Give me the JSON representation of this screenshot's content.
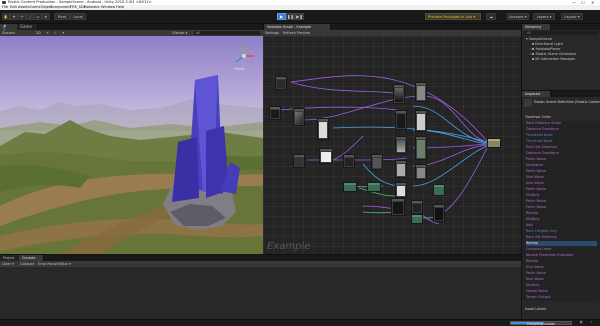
{
  "window": {
    "title": "Elastic Content Production - SampleScene - Android - Unity 2020.3.3f1 <DX11>",
    "controls": [
      "—",
      "☐",
      "✕"
    ]
  },
  "menu": [
    "File",
    "Edit",
    "Assets",
    "GameObject",
    "Component",
    "FRE_SDK",
    "Hololabs",
    "Window",
    "Help"
  ],
  "toolbar": {
    "tools": [
      "✋",
      "✥",
      "⟳",
      "⤢",
      "▭",
      "⊕"
    ],
    "pivot": "Pivot",
    "local": "Local",
    "package_badge": "Preview Packages in Use ▾",
    "account": "Account ▾",
    "layers": "Layers ▾",
    "layout": "Layout ▾",
    "play": "▶",
    "pause": "❚❚",
    "step": "▶❚"
  },
  "scene_panel": {
    "tabs": [
      "# Scene",
      "Game"
    ],
    "shading": "Shaded",
    "mode_2d": "2D",
    "gizmos": "Gizmos ▾",
    "search": "All",
    "persp_label": "<Persp"
  },
  "graph_panel": {
    "tab": "Hololabs Graph - Example",
    "settings": "Settings",
    "refresh": "Refresh Preview",
    "watermark": "Example"
  },
  "hierarchy": {
    "tab": "Hierarchy",
    "search": "All",
    "scene": "SampleScene",
    "items": [
      "Directional Light",
      "HololabsPlayer",
      "Elastic Scene Generator",
      "XR Interaction Manager"
    ]
  },
  "inspector": {
    "tab": "Inspector",
    "object_title": "Elastic Scene Definition (Elastic Content...",
    "section": "Traversal Order",
    "rows": [
      "Rock Distance Stripe",
      "Distance Transform",
      "Threshold Node",
      "Threshold Node",
      "Rock Set Distance",
      "Distance Transform",
      "Perlin Noise",
      "Normalize",
      "Perlin Noise",
      "Sine Wave",
      "Sine Wave",
      "Perlin Noise",
      "Multiply",
      "Perlin Noise",
      "Perlin Noise",
      "Remap",
      "Multiply",
      "Add",
      "Rock Heights Only",
      "Rock Set Distance",
      "Remap",
      "Combine Layer",
      "Normal Projection Evaluator",
      "Remap",
      "Sine Wave",
      "Perlin Noise",
      "Sine Wave",
      "Multiply",
      "Fractal Noise",
      "Terrain Output"
    ],
    "selected_index": 20,
    "dim_indices": [
      2,
      3,
      18
    ],
    "asset_labels": "Asset Labels"
  },
  "bottom": {
    "tabs": [
      "Project",
      "Console"
    ],
    "controls": [
      "Clear ▾",
      "Collapse",
      "Error Pause",
      "Editor ▾"
    ]
  },
  "status": {
    "progress_label": "Compiling shader",
    "progress": 0.55
  },
  "colors": {
    "accent": "#3d7fd6",
    "badge": "#f0b433",
    "inspector_text": "#b06bd0",
    "edge_purple": "#9d5ce8",
    "edge_blue": "#4da3e8",
    "edge_green": "#58b88a",
    "crystal": "#4a3fbf"
  }
}
